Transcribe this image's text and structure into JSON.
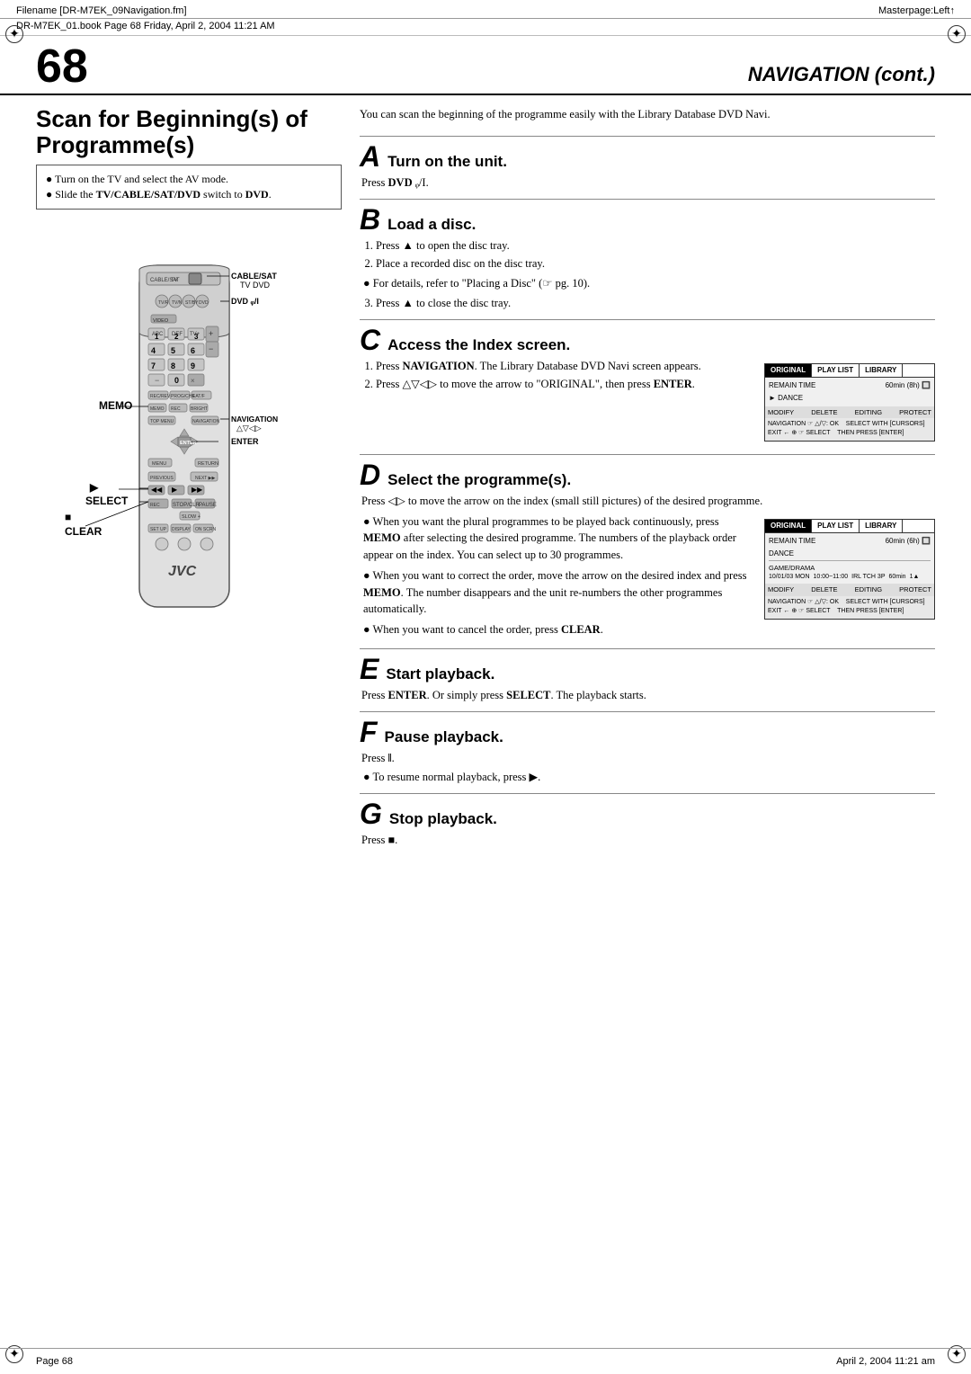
{
  "meta": {
    "filename": "Filename [DR-M7EK_09Navigation.fm]",
    "book_ref": "DR-M7EK_01.book  Page 68  Friday, April 2, 2004  11:21 AM",
    "masterpage": "Masterpage:Left↑",
    "page_num": "68",
    "nav_cont": "NAVIGATION (cont.)",
    "footer_page": "Page 68",
    "footer_date": "April 2, 2004  11:21 am"
  },
  "section": {
    "title": "Scan for Beginning(s) of Programme(s)",
    "intro": "You can scan the beginning of the programme easily with the Library Database DVD Navi.",
    "prereq": [
      "Turn on the TV and select the AV mode.",
      "Slide the TV/CABLE/SAT/DVD switch to DVD."
    ]
  },
  "remote": {
    "labels": {
      "cable_sat": "CABLE/SAT",
      "tv": "TV",
      "dvd": "DVD",
      "dvd_power": "DVD ᵩ/I",
      "memo": "MEMO",
      "navigation": "NAVIGATION",
      "nav_arrows": "△▽◁▷",
      "enter": "ENTER",
      "select": "SELECT",
      "clear": "CLEAR",
      "jvc": "JVC"
    }
  },
  "steps": {
    "A": {
      "letter": "A",
      "title": "Turn on the unit.",
      "body": "Press DVD ᵩ/I."
    },
    "B": {
      "letter": "B",
      "title": "Load a disc.",
      "steps": [
        "Press ▲ to open the disc tray.",
        "Place a recorded disc on the disc tray.",
        "For details, refer to \"Placing a Disc\" (☞ pg. 10).",
        "Press ▲ to close the disc tray."
      ],
      "note_prefix": "● ",
      "note": "For details, refer to \"Placing a Disc\" (☞ pg. 10)."
    },
    "C": {
      "letter": "C",
      "title": "Access the Index screen.",
      "steps": [
        "Press NAVIGATION. The Library Database DVD Navi screen appears.",
        "Press △▽◁▷ to move the arrow to \"ORIGINAL\", then press ENTER."
      ],
      "screen1": {
        "tabs": [
          "ORIGINAL",
          "PLAY LIST",
          "LIBRARY"
        ],
        "active_tab": "ORIGINAL",
        "rows": [
          {
            "label": "DANCE",
            "value": ""
          }
        ],
        "footer_items": [
          "MODIFY",
          "DELETE",
          "EDITING",
          "PROTECT"
        ],
        "nav_text": "NAVIGATION ☞ △/▽: OK    SELECT WITH [CURSORS]",
        "exit_text": "EXIT ← ⊕ ☞ SELECT    THEN PRESS [ENTER]"
      }
    },
    "D": {
      "letter": "D",
      "title": "Select the programme(s).",
      "intro": "Press ◁▷ to move the arrow on the index (small still pictures) of the desired programme.",
      "bullets": [
        {
          "text": "When you want the plural programmes to be played back continuously, press MEMO after selecting the desired programme. The numbers of the playback order appear on the index. You can select up to 30 programmes."
        },
        {
          "text": "When you want to correct the order, move the arrow on the desired index and press MEMO. The number disappears and the unit re-numbers the other programmes automatically."
        },
        {
          "text": "When you want to cancel the order, press CLEAR."
        }
      ],
      "screen2": {
        "tabs": [
          "ORIGINAL",
          "PLAY LIST",
          "LIBRARY"
        ],
        "active_tab": "ORIGINAL",
        "rows": [
          {
            "label": "DANCE",
            "value": ""
          },
          {
            "label": "GAME / DRAMA",
            "col2": "10/01/03 MON",
            "col3": "10:00~11:00",
            "col4": "IRL TCH 3P",
            "col5": "60min",
            "col6": "1▲"
          }
        ],
        "footer_items": [
          "MODIFY",
          "DELETE",
          "EDITING",
          "PROTECT"
        ],
        "nav_text": "NAVIGATION ☞ △/▽: OK    SELECT WITH [CURSORS]",
        "exit_text": "EXIT ← ⊕ ☞ SELECT    THEN PRESS [ENTER]"
      }
    },
    "E": {
      "letter": "E",
      "title": "Start playback.",
      "body": "Press ENTER. Or simply press SELECT. The playback starts."
    },
    "F": {
      "letter": "F",
      "title": "Pause playback.",
      "body": "Press ‖.",
      "bullet": "To resume normal playback, press ▶."
    },
    "G": {
      "letter": "G",
      "title": "Stop playback.",
      "body": "Press ■."
    }
  }
}
